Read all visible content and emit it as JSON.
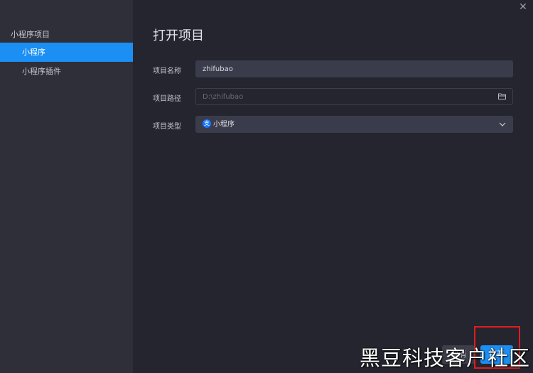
{
  "sidebar": {
    "group_label": "小程序项目",
    "items": [
      {
        "label": "小程序"
      },
      {
        "label": "小程序插件"
      }
    ]
  },
  "main": {
    "title": "打开项目",
    "close_icon": "close-icon",
    "fields": {
      "name": {
        "label": "项目名称",
        "value": "zhifubao"
      },
      "path": {
        "label": "项目路径",
        "placeholder": "D:\\zhifubao",
        "icon": "folder-icon"
      },
      "type": {
        "label": "项目类型",
        "value": "小程序",
        "icon": "alipay-icon",
        "chevron": "chevron-down-icon"
      }
    }
  },
  "buttons": {
    "cancel_label": "取消",
    "confirm_label": "打开"
  },
  "watermark": "黑豆科技客户社区",
  "colors": {
    "accent": "#1b8ff3",
    "sidebar_bg": "#2e2f39",
    "main_bg": "#24252f",
    "highlight": "#e21c1c"
  }
}
